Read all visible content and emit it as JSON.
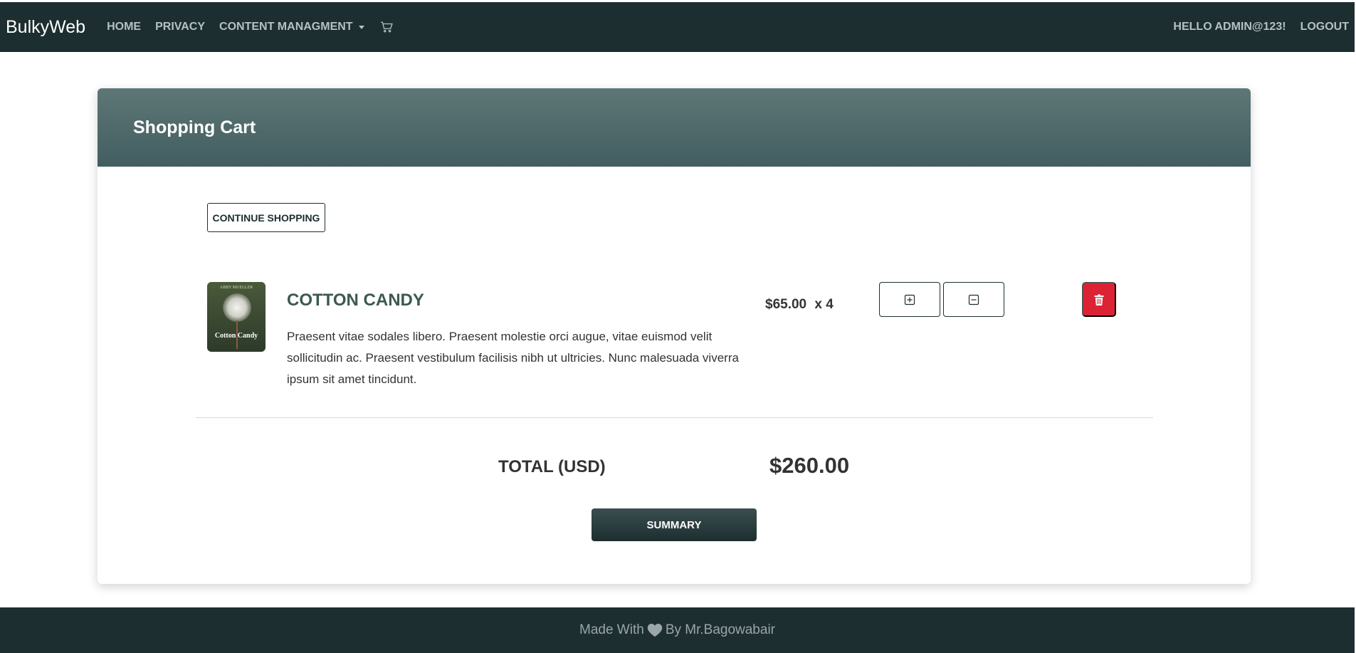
{
  "navbar": {
    "brand": "BulkyWeb",
    "links": [
      "HOME",
      "PRIVACY",
      "CONTENT MANAGMENT"
    ],
    "greeting": "HELLO ADMIN@123!",
    "logout": "LOGOUT",
    "cart_icon": "cart-icon",
    "dropdown_icon": "caret-down-icon"
  },
  "card": {
    "title": "Shopping Cart",
    "continue_label": "CONTINUE SHOPPING"
  },
  "cart_item": {
    "cover_author": "ABBY MUELLER",
    "cover_title": "Cotton Candy",
    "title": "COTTON CANDY",
    "description": "Praesent vitae sodales libero. Praesent molestie orci augue, vitae euismod velit sollicitudin ac. Praesent vestibulum facilisis nibh ut ultricies. Nunc malesuada viverra ipsum sit amet tincidunt.",
    "price": "$65.00",
    "quantity_text": "x 4",
    "increment_icon": "plus-square-icon",
    "decrement_icon": "minus-square-icon",
    "delete_icon": "trash-icon"
  },
  "totals": {
    "label": "TOTAL (USD)",
    "value": "$260.00",
    "summary_label": "SUMMARY"
  },
  "footer": {
    "prefix": "Made With",
    "suffix": "By Mr.Bagowabair",
    "heart_icon": "heart-icon"
  },
  "colors": {
    "navbar_bg": "#1d2e30",
    "header_gradient_top": "#5e7676",
    "header_gradient_bottom": "#425e60",
    "product_title": "#3b5a4e",
    "delete_button": "#dc2335"
  }
}
